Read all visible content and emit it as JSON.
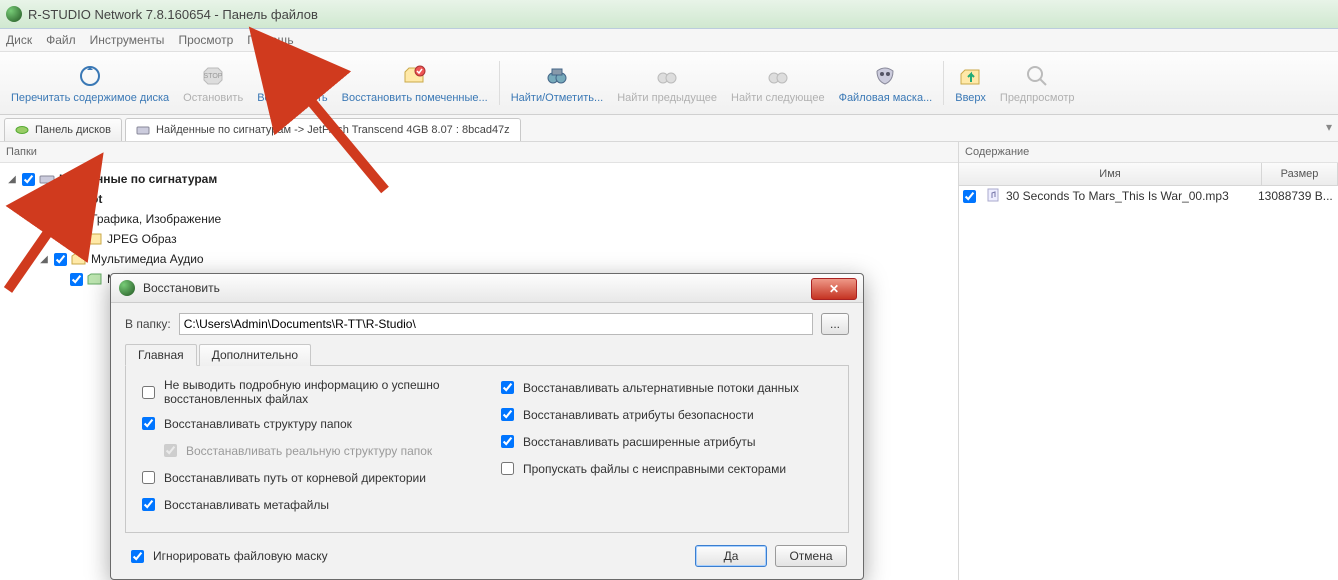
{
  "title": "R-STUDIO Network 7.8.160654 - Панель файлов",
  "menu": [
    "Диск",
    "Файл",
    "Инструменты",
    "Просмотр",
    "Помощь"
  ],
  "toolbar": [
    {
      "id": "reread",
      "label": "Перечитать содержимое диска",
      "dis": false
    },
    {
      "id": "stop",
      "label": "Остановить",
      "dis": true
    },
    {
      "id": "recover",
      "label": "Восстановить",
      "dis": false
    },
    {
      "id": "recover-marked",
      "label": "Восстановить помеченные...",
      "dis": false
    },
    {
      "id": "find",
      "label": "Найти/Отметить...",
      "dis": false
    },
    {
      "id": "find-prev",
      "label": "Найти предыдущее",
      "dis": true
    },
    {
      "id": "find-next",
      "label": "Найти следующее",
      "dis": true
    },
    {
      "id": "mask",
      "label": "Файловая маска...",
      "dis": false
    },
    {
      "id": "up",
      "label": "Вверх",
      "dis": false
    },
    {
      "id": "preview",
      "label": "Предпросмотр",
      "dis": true
    }
  ],
  "tabs": {
    "panel_disks": "Панель дисков",
    "found": "Найденные по сигнатурам -> JetFlash Transcend 4GB 8.07 : 8bcad47z"
  },
  "leftpane_title": "Папки",
  "tree": {
    "root": "Найденные по сигнатурам",
    "l1": "Root",
    "l2a": "Графика, Изображение",
    "l3a": "JPEG Образ",
    "l2b": "Мультимедиа Аудио",
    "l3b": "MPEG Layer III Аудио"
  },
  "rightpane_title": "Содержание",
  "columns": {
    "name": "Имя",
    "size": "Размер"
  },
  "file": {
    "name": "30 Seconds To Mars_This Is War_00.mp3",
    "size": "13088739 B..."
  },
  "dialog": {
    "title": "Восстановить",
    "to_folder_label": "В папку:",
    "to_folder_value": "C:\\Users\\Admin\\Documents\\R-TT\\R-Studio\\",
    "browse": "...",
    "tab_main": "Главная",
    "tab_adv": "Дополнительно",
    "opt_no_details": "Не выводить подробную информацию о успешно восстановленных файлах",
    "opt_struct": "Восстанавливать структуру папок",
    "opt_real_struct": "Восстанавливать реальную структуру папок",
    "opt_root_path": "Восстанавливать путь от корневой директории",
    "opt_metafiles": "Восстанавливать метафайлы",
    "opt_alt_streams": "Восстанавливать альтернативные потоки данных",
    "opt_security": "Восстанавливать атрибуты безопасности",
    "opt_extended": "Восстанавливать расширенные атрибуты",
    "opt_skip_bad": "Пропускать файлы с неисправными секторами",
    "opt_ignore_mask": "Игнорировать файловую маску",
    "ok": "Да",
    "cancel": "Отмена"
  }
}
